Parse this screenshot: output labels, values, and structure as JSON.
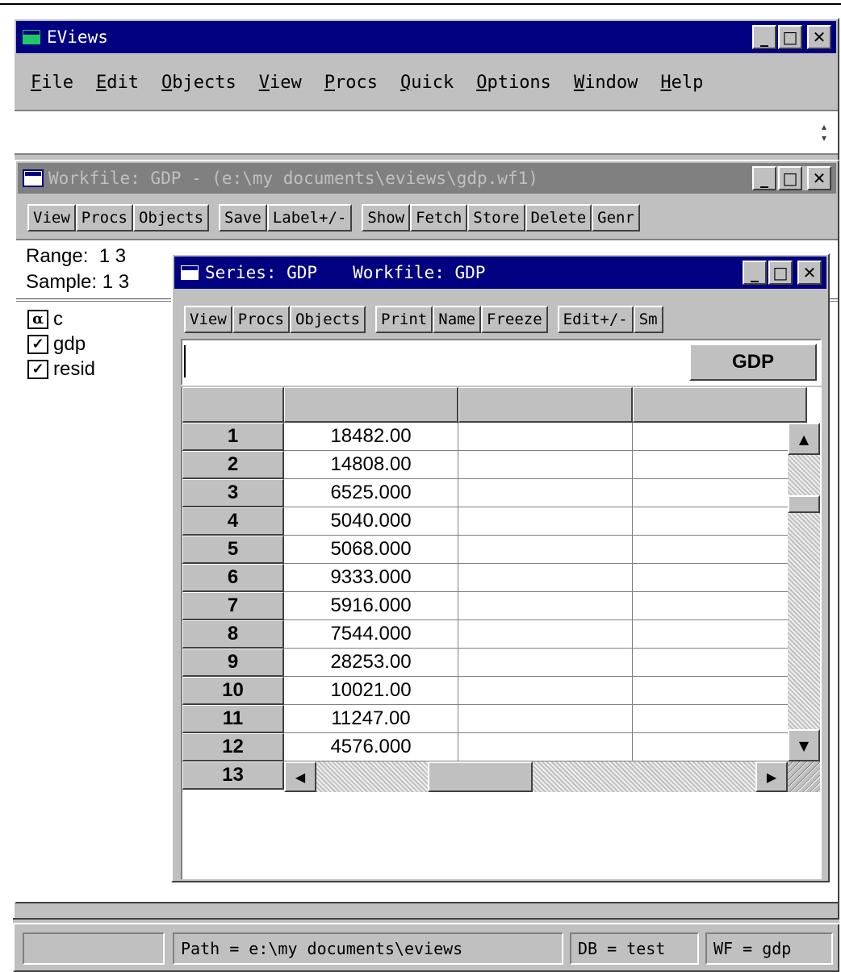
{
  "app": {
    "title": "EViews",
    "menu": [
      {
        "label": "File",
        "accel": "F",
        "rest": "ile"
      },
      {
        "label": "Edit",
        "accel": "E",
        "rest": "dit"
      },
      {
        "label": "Objects",
        "accel": "O",
        "rest": "bjects"
      },
      {
        "label": "View",
        "accel": "V",
        "rest": "iew"
      },
      {
        "label": "Procs",
        "accel": "P",
        "rest": "rocs"
      },
      {
        "label": "Quick",
        "accel": "Q",
        "rest": "uick"
      },
      {
        "label": "Options",
        "accel": "O",
        "rest": "ptions"
      },
      {
        "label": "Window",
        "accel": "W",
        "rest": "indow"
      },
      {
        "label": "Help",
        "accel": "H",
        "rest": "elp"
      }
    ],
    "command_value": ""
  },
  "workfile": {
    "title": "Workfile: GDP - (e:\\my documents\\eviews\\gdp.wf1)",
    "buttons": [
      "View",
      "Procs",
      "Objects",
      "Save",
      "Label+/-",
      "Show",
      "Fetch",
      "Store",
      "Delete",
      "Genr"
    ],
    "range_label": "Range:  1 3",
    "sample_label": "Sample: 1 3",
    "objects": [
      {
        "icon": "α",
        "icon_name": "coefficient-icon",
        "name": "c"
      },
      {
        "icon": "✓",
        "icon_name": "series-icon",
        "name": "gdp"
      },
      {
        "icon": "✓",
        "icon_name": "series-icon",
        "name": "resid"
      }
    ]
  },
  "series": {
    "title_series": "Series: GDP",
    "title_workfile": "Workfile: GDP",
    "buttons": [
      "View",
      "Procs",
      "Objects",
      "Print",
      "Name",
      "Freeze",
      "Edit+/-",
      "Sm"
    ],
    "edit_value": "",
    "column_name": "GDP",
    "rows": [
      {
        "obs": "1",
        "value": "18482.00"
      },
      {
        "obs": "2",
        "value": "14808.00"
      },
      {
        "obs": "3",
        "value": "6525.000"
      },
      {
        "obs": "4",
        "value": "5040.000"
      },
      {
        "obs": "5",
        "value": "5068.000"
      },
      {
        "obs": "6",
        "value": "9333.000"
      },
      {
        "obs": "7",
        "value": "5916.000"
      },
      {
        "obs": "8",
        "value": "7544.000"
      },
      {
        "obs": "9",
        "value": "28253.00"
      },
      {
        "obs": "10",
        "value": "10021.00"
      },
      {
        "obs": "11",
        "value": "11247.00"
      },
      {
        "obs": "12",
        "value": "4576.000"
      },
      {
        "obs": "13",
        "value": ""
      }
    ]
  },
  "status_bar": {
    "path": "Path = e:\\my documents\\eviews",
    "db": "DB = test",
    "wf": "WF = gdp"
  },
  "window_buttons": {
    "minimize": "_",
    "maximize": "□",
    "close": "✕"
  },
  "colors": {
    "active_title": "#000080",
    "inactive_title": "#808080",
    "face": "#c0c0c0"
  }
}
